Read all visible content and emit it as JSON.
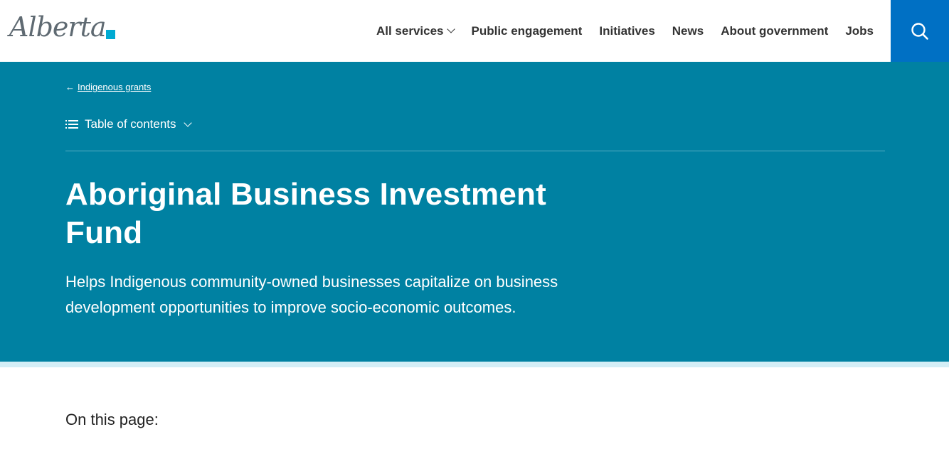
{
  "header": {
    "logo_text": "Alberta",
    "nav": [
      {
        "label": "All services",
        "has_dropdown": true
      },
      {
        "label": "Public engagement"
      },
      {
        "label": "Initiatives"
      },
      {
        "label": "News"
      },
      {
        "label": "About government"
      },
      {
        "label": "Jobs"
      }
    ],
    "search_icon": "search-icon"
  },
  "hero": {
    "back_link": "Indigenous grants",
    "toc_label": "Table of contents",
    "title": "Aboriginal Business Investment Fund",
    "lead": "Helps Indigenous community-owned businesses capitalize on business development opportunities to improve socio-economic outcomes."
  },
  "content": {
    "on_this_page": "On this page:"
  },
  "colors": {
    "hero_bg": "#0081a2",
    "search_bg": "#0070c4",
    "logo_accent": "#00aad2",
    "hero_bottom_stripe": "#d3eef6"
  }
}
